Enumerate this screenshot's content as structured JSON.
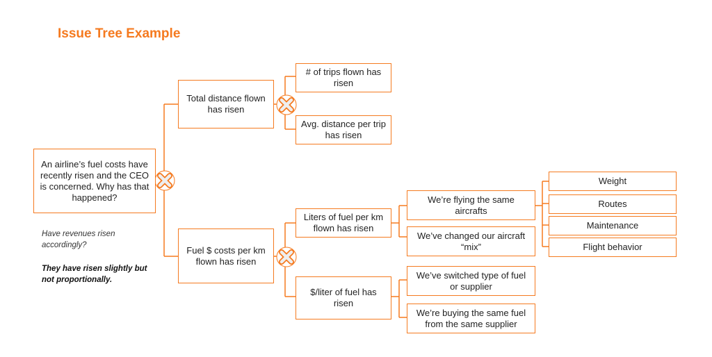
{
  "title": "Issue Tree Example",
  "root": "An airline’s fuel costs have recently risen and the CEO is concerned. Why has that happened?",
  "notes": {
    "question": "Have revenues risen accordingly?",
    "answer": "They have risen slightly but not proportionally."
  },
  "level1": [
    {
      "label": "Total distance flown has risen"
    },
    {
      "label": "Fuel $ costs per km flown has risen"
    }
  ],
  "level2": [
    {
      "label": "# of trips flown has risen"
    },
    {
      "label": "Avg. distance per trip has risen"
    },
    {
      "label": "Liters of fuel per km flown has risen"
    },
    {
      "label": "$/liter of fuel has risen"
    }
  ],
  "level3": [
    {
      "label": "We’re flying the same aircrafts"
    },
    {
      "label": "We’ve changed our aircraft “mix”"
    },
    {
      "label": "We’ve switched type of fuel or supplier"
    },
    {
      "label": "We’re buying the same fuel from the same supplier"
    }
  ],
  "level4": [
    {
      "label": "Weight"
    },
    {
      "label": "Routes"
    },
    {
      "label": "Maintenance"
    },
    {
      "label": "Flight behavior"
    }
  ],
  "icons": {
    "mece_marker": "x-cross-icon"
  },
  "colors": {
    "accent": "#f57a1f",
    "icon_fill": "#eeeeee"
  }
}
